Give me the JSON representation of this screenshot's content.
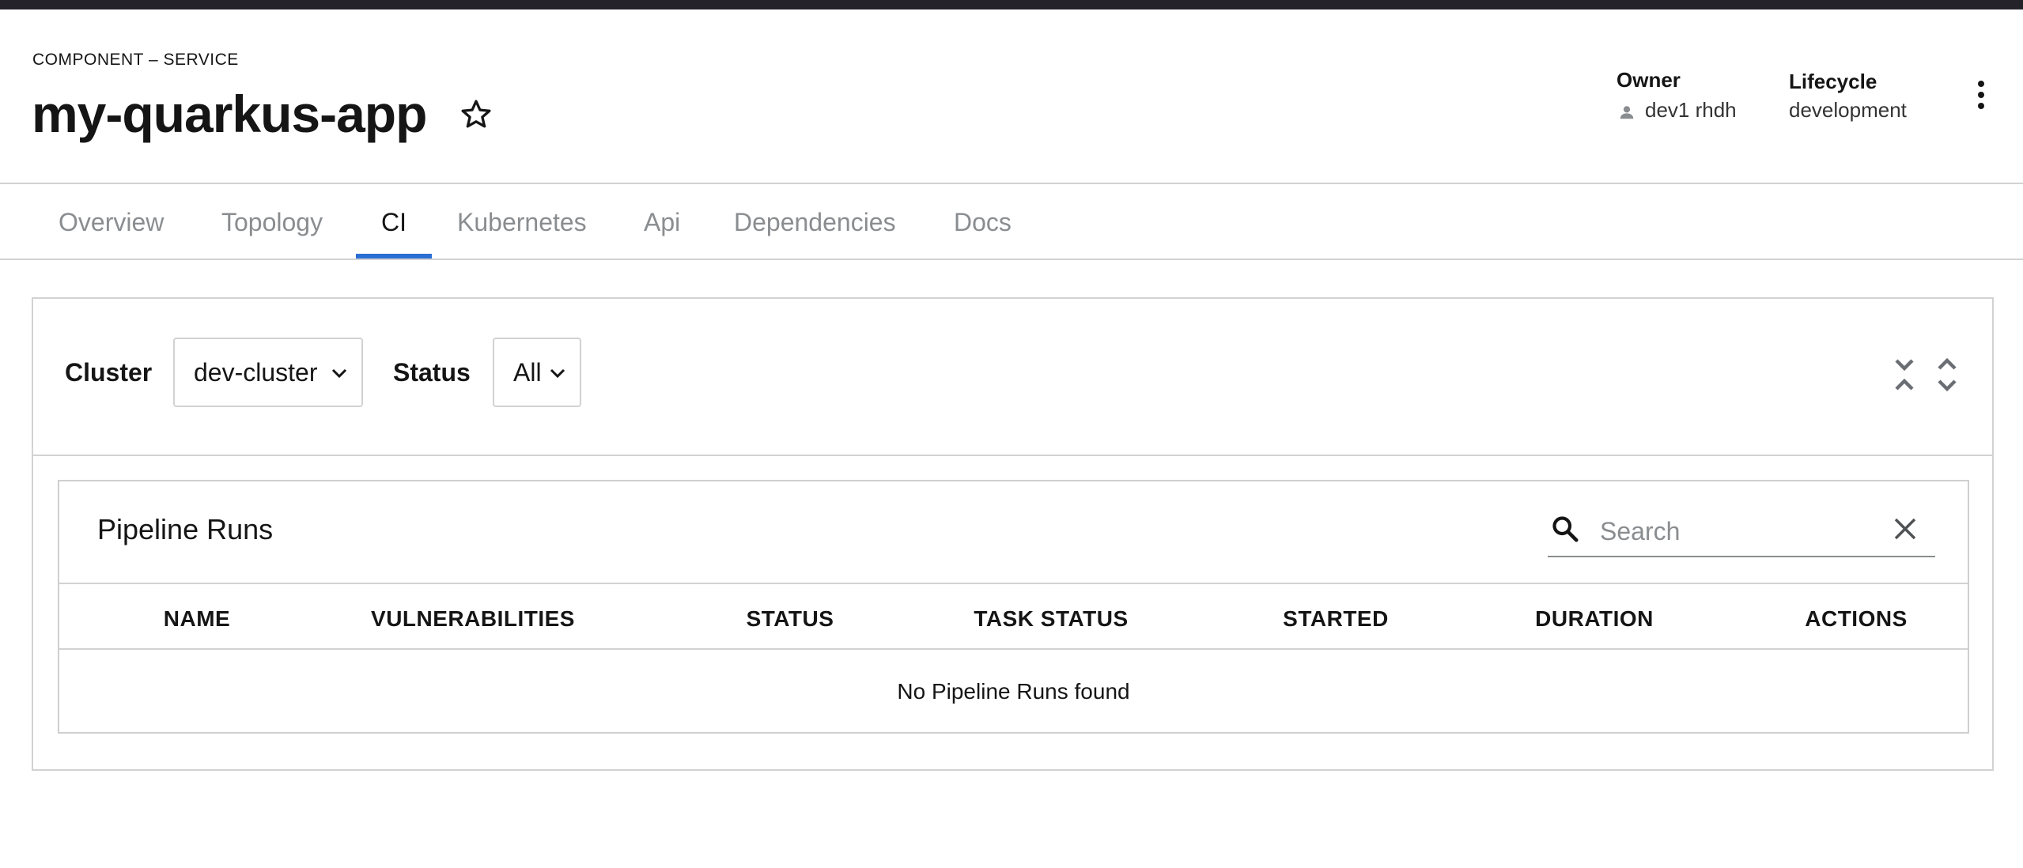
{
  "header": {
    "subtitle": "COMPONENT – SERVICE",
    "title": "my-quarkus-app",
    "owner_label": "Owner",
    "owner_value": "dev1 rhdh",
    "lifecycle_label": "Lifecycle",
    "lifecycle_value": "development"
  },
  "tabs": [
    {
      "label": "Overview"
    },
    {
      "label": "Topology"
    },
    {
      "label": "CI",
      "active": true
    },
    {
      "label": "Kubernetes"
    },
    {
      "label": "Api"
    },
    {
      "label": "Dependencies"
    },
    {
      "label": "Docs"
    }
  ],
  "filters": {
    "cluster_label": "Cluster",
    "cluster_value": "dev-cluster",
    "status_label": "Status",
    "status_value": "All"
  },
  "pipeline_runs": {
    "title": "Pipeline Runs",
    "search_placeholder": "Search",
    "columns": [
      "NAME",
      "VULNERABILITIES",
      "STATUS",
      "TASK STATUS",
      "STARTED",
      "DURATION",
      "ACTIONS"
    ],
    "empty_message": "No Pipeline Runs found"
  },
  "colors": {
    "accent": "#2b6fd4",
    "topbar": "#232329"
  }
}
